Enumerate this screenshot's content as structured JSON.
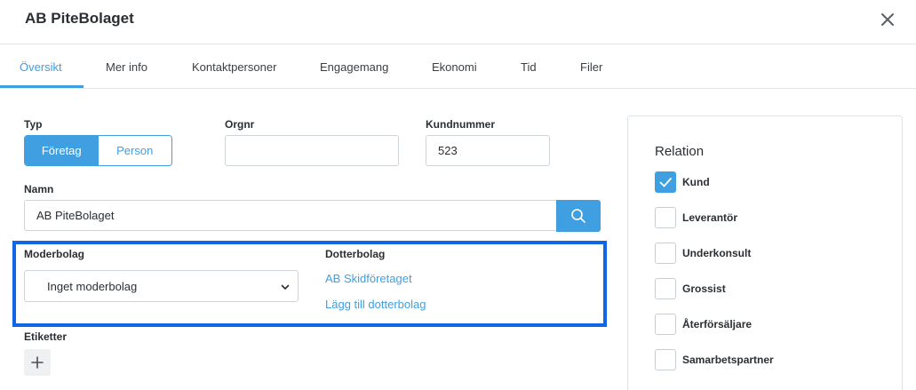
{
  "header": {
    "title": "AB PiteBolaget",
    "close_icon": "close-icon"
  },
  "tabs": [
    {
      "label": "Översikt",
      "active": true
    },
    {
      "label": "Mer info",
      "active": false
    },
    {
      "label": "Kontaktpersoner",
      "active": false
    },
    {
      "label": "Engagemang",
      "active": false
    },
    {
      "label": "Ekonomi",
      "active": false
    },
    {
      "label": "Tid",
      "active": false
    },
    {
      "label": "Filer",
      "active": false
    }
  ],
  "form": {
    "typ_label": "Typ",
    "typ_options": [
      "Företag",
      "Person"
    ],
    "typ_selected": "Företag",
    "orgnr_label": "Orgnr",
    "orgnr_value": "",
    "kundnummer_label": "Kundnummer",
    "kundnummer_value": "523",
    "namn_label": "Namn",
    "namn_value": "AB PiteBolaget",
    "search_icon": "search-icon",
    "moderbolag_label": "Moderbolag",
    "moderbolag_value": "Inget moderbolag",
    "dotterbolag_label": "Dotterbolag",
    "dotterbolag_items": [
      "AB Skidföretaget"
    ],
    "add_dotterbolag_label": "Lägg till dotterbolag",
    "etiketter_label": "Etiketter",
    "add_icon": "plus-icon"
  },
  "relation": {
    "title": "Relation",
    "options": [
      {
        "label": "Kund",
        "checked": true
      },
      {
        "label": "Leverantör",
        "checked": false
      },
      {
        "label": "Underkonsult",
        "checked": false
      },
      {
        "label": "Grossist",
        "checked": false
      },
      {
        "label": "Återförsäljare",
        "checked": false
      },
      {
        "label": "Samarbetspartner",
        "checked": false
      }
    ]
  },
  "colors": {
    "accent": "#3f9fe0",
    "highlight": "#1166e6"
  }
}
